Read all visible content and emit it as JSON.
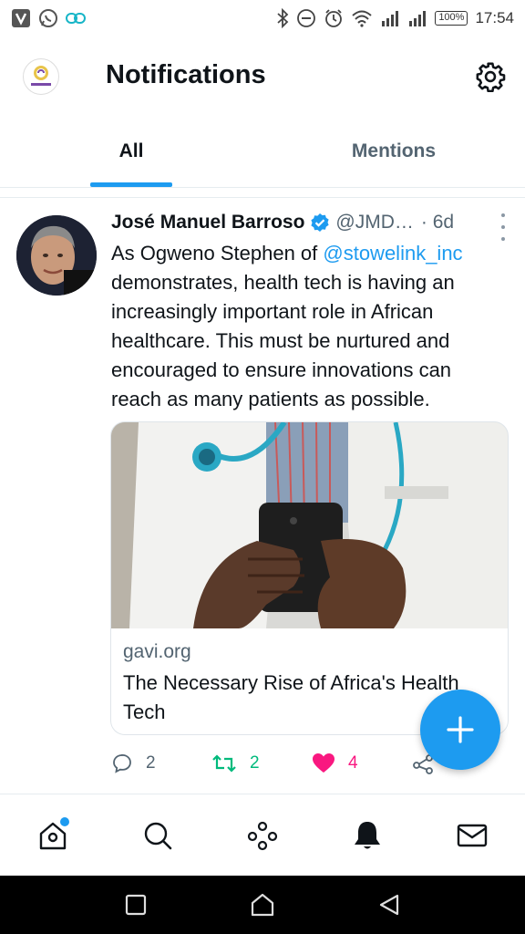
{
  "status_bar": {
    "battery": "100%",
    "time": "17:54"
  },
  "header": {
    "title": "Notifications"
  },
  "tabs": [
    {
      "label": "All",
      "active": true
    },
    {
      "label": "Mentions",
      "active": false
    }
  ],
  "tweet": {
    "author_name": "José Manuel Barroso",
    "handle": "@JMD…",
    "time": "· 6d",
    "text_before": "As Ogweno Stephen of ",
    "mention": "@stowelink_inc",
    "text_after": " demonstrates, health tech is having an increasingly important role in African healthcare. This must be nurtured and encouraged to ensure innovations can reach as many patients as possible.",
    "card": {
      "domain": "gavi.org",
      "title": "The Necessary Rise of Africa's Health Tech"
    },
    "actions": {
      "replies": "2",
      "retweets": "2",
      "likes": "4"
    }
  },
  "colors": {
    "accent": "#1d9bf0",
    "retweet": "#00ba7c",
    "like": "#f91880"
  },
  "icons": {
    "status_left": [
      "v-app-icon",
      "whatsapp-icon",
      "link-icon"
    ],
    "status_right": [
      "bluetooth-icon",
      "dnd-icon",
      "alarm-icon",
      "wifi-icon",
      "signal-icon",
      "signal-icon",
      "battery-icon"
    ],
    "nav": [
      "home-icon",
      "search-icon",
      "spaces-icon",
      "bell-icon",
      "mail-icon"
    ],
    "android": [
      "recents-icon",
      "home-icon",
      "back-icon"
    ]
  }
}
